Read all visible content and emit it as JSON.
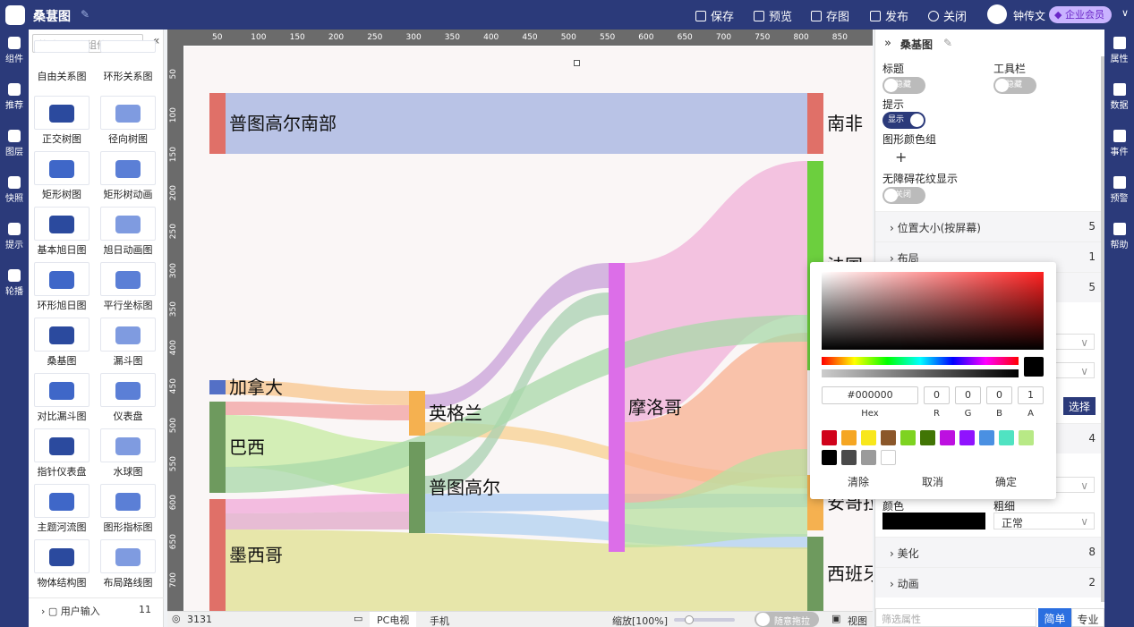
{
  "topbar": {
    "title": "桑葚图",
    "save": "保存",
    "preview": "预览",
    "saveimg": "存图",
    "publish": "发布",
    "close": "关闭",
    "user": "钟传文",
    "vip": "企业会员"
  },
  "leftrail": [
    {
      "label": "组件",
      "icon": "cube-icon"
    },
    {
      "label": "推荐",
      "icon": "cubes-icon"
    },
    {
      "label": "图层",
      "icon": "layers-icon"
    },
    {
      "label": "快照",
      "icon": "camera-icon"
    },
    {
      "label": "提示",
      "icon": "bulb-icon"
    },
    {
      "label": "轮播",
      "icon": "windows-icon"
    }
  ],
  "components": {
    "search_placeholder": "筛选137个组件",
    "items": [
      "自由关系图",
      "环形关系图",
      "正交树图",
      "径向树图",
      "矩形树图",
      "矩形树动画",
      "基本旭日图",
      "旭日动画图",
      "环形旭日图",
      "平行坐标图",
      "桑基图",
      "漏斗图",
      "对比漏斗图",
      "仪表盘",
      "指针仪表盘",
      "水球图",
      "主题河流图",
      "图形指标图",
      "物体结构图",
      "布局路线图"
    ],
    "footer_label": "用户输入",
    "footer_count": "11"
  },
  "ruler": {
    "h": [
      "50",
      "100",
      "150",
      "200",
      "250",
      "300",
      "350",
      "400",
      "450",
      "500",
      "550",
      "600",
      "650",
      "700",
      "750",
      "800",
      "850"
    ],
    "v": [
      "50",
      "100",
      "150",
      "200",
      "250",
      "300",
      "350",
      "400",
      "450",
      "500",
      "550",
      "600",
      "650",
      "700"
    ]
  },
  "sankey": {
    "nodes": [
      {
        "name": "普图高尔南部",
        "color": "#e07068"
      },
      {
        "name": "加拿大",
        "color": "#5470c6"
      },
      {
        "name": "巴西",
        "color": "#6e9a5e"
      },
      {
        "name": "墨西哥",
        "color": "#e07068"
      },
      {
        "name": "英格兰",
        "color": "#f5b150"
      },
      {
        "name": "普图高尔",
        "color": "#6e9a5e"
      },
      {
        "name": "摩洛哥",
        "color": "#dc6ee8"
      },
      {
        "name": "南非",
        "color": "#e07068"
      },
      {
        "name": "法国",
        "color": "#6ccf3e"
      },
      {
        "name": "安哥拉",
        "color": "#f5b150"
      },
      {
        "name": "西班牙",
        "color": "#6e9a5e"
      }
    ]
  },
  "bottombar": {
    "id": "3131",
    "pc": "PC电视",
    "mobile": "手机",
    "zoom": "缩放[100%]",
    "drag": "随意拖拉",
    "view": "视图"
  },
  "props": {
    "title": "桑基图",
    "label_title": "标题",
    "label_toolbar": "工具栏",
    "hidden": "隐藏",
    "label_tip": "提示",
    "show": "显示",
    "label_palette": "图形颜色组",
    "label_a11y": "无障碍花纹显示",
    "off": "关闭",
    "sections": [
      {
        "label": "位置大小(按屏幕)",
        "count": "5"
      },
      {
        "label": "布局",
        "count": "1"
      },
      {
        "label": "",
        "count": "5"
      },
      {
        "label": "",
        "count": "4"
      },
      {
        "label": "美化",
        "count": "8"
      },
      {
        "label": "动画",
        "count": "2"
      }
    ],
    "select_btn": "选择",
    "color_label": "颜色",
    "weight_label": "粗细",
    "weight_value": "正常",
    "filter_placeholder": "筛选属性",
    "simple": "简单",
    "pro": "专业"
  },
  "rightrail": [
    {
      "label": "属性",
      "icon": "props-icon"
    },
    {
      "label": "数据",
      "icon": "database-icon"
    },
    {
      "label": "事件",
      "icon": "event-icon"
    },
    {
      "label": "预警",
      "icon": "alarm-icon"
    },
    {
      "label": "帮助",
      "icon": "help-icon"
    }
  ],
  "picker": {
    "hex": "#000000",
    "r": "0",
    "g": "0",
    "b": "0",
    "a": "1",
    "hex_label": "Hex",
    "r_label": "R",
    "g_label": "G",
    "b_label": "B",
    "a_label": "A",
    "swatches": [
      "#d0021b",
      "#f5a623",
      "#f8e71c",
      "#8b572a",
      "#7ed321",
      "#417505",
      "#bd10e0",
      "#9013fe",
      "#4a90e2",
      "#50e3c2",
      "#b8e986",
      "#000000",
      "#4a4a4a",
      "#9b9b9b",
      "#ffffff"
    ],
    "clear": "清除",
    "cancel": "取消",
    "ok": "确定"
  }
}
